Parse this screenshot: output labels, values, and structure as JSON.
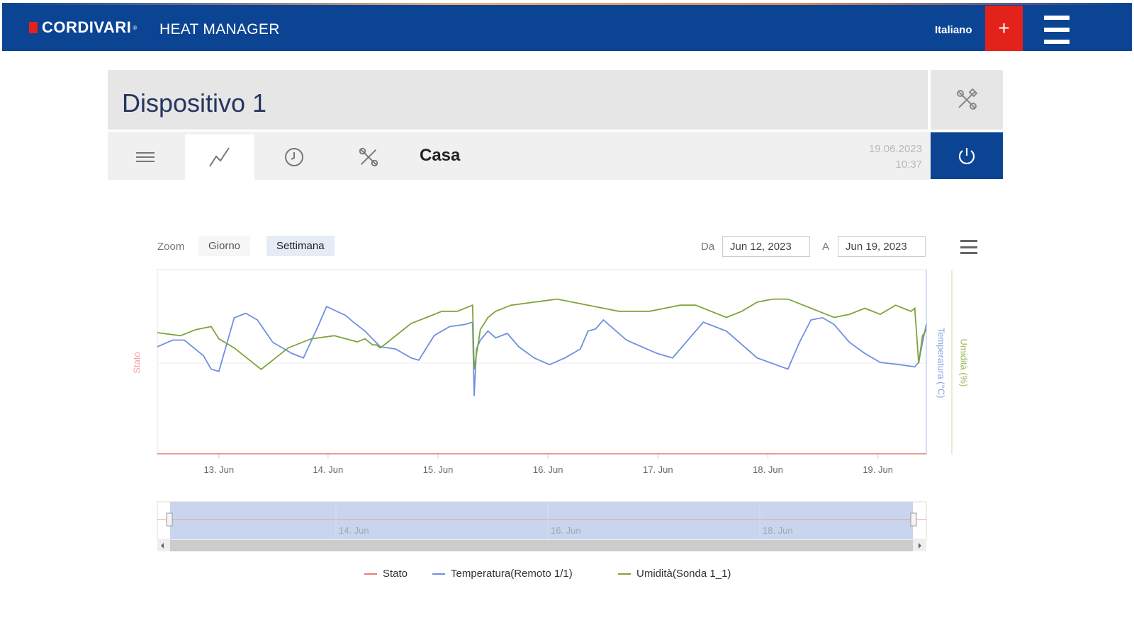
{
  "header": {
    "brand": "CORDIVARI",
    "brand_reg": "®",
    "app_name": "HEAT MANAGER",
    "language": "Italiano",
    "add_label": "+",
    "colors": {
      "bar": "#0c4494",
      "accent": "#e3231b"
    }
  },
  "device": {
    "title": "Dispositivo 1",
    "tabs": [
      {
        "icon": "list-icon"
      },
      {
        "icon": "chart-line-icon",
        "active": true
      },
      {
        "icon": "clock-icon"
      },
      {
        "icon": "tools-icon"
      }
    ],
    "location": "Casa",
    "date": "19.06.2023",
    "time": "10:37"
  },
  "chart_controls": {
    "zoom_label": "Zoom",
    "zoom_day": "Giorno",
    "zoom_week": "Settimana",
    "from_label": "Da",
    "from_value": "Jun 12, 2023",
    "to_label": "A",
    "to_value": "Jun 19, 2023"
  },
  "chart_data": {
    "type": "line",
    "x_start": "2023-06-12 12:00",
    "x_end": "2023-06-19 10:37",
    "x_ticks": [
      "13. Jun",
      "14. Jun",
      "15. Jun",
      "16. Jun",
      "17. Jun",
      "18. Jun",
      "19. Jun"
    ],
    "y_axes": [
      {
        "title": "Stato",
        "color": "#f3a0a0",
        "side": "left"
      },
      {
        "title": "Temperatura (°C)",
        "color": "#8aa4e6",
        "side": "right"
      },
      {
        "title": "Umidità (%)",
        "color": "#9cb85a",
        "side": "right"
      }
    ],
    "series": [
      {
        "name": "Stato",
        "color": "#ee7a7a",
        "axis": "Stato",
        "x": [
          0,
          1
        ],
        "y": [
          0,
          0
        ]
      },
      {
        "name": "Temperatura(Remoto 1/1)",
        "color": "#6f8fe0",
        "axis": "Temperatura (°C)",
        "x": [
          0.0,
          0.02,
          0.035,
          0.06,
          0.07,
          0.08,
          0.1,
          0.115,
          0.13,
          0.15,
          0.175,
          0.19,
          0.21,
          0.22,
          0.245,
          0.255,
          0.27,
          0.29,
          0.31,
          0.33,
          0.34,
          0.36,
          0.38,
          0.4,
          0.41,
          0.412,
          0.415,
          0.42,
          0.43,
          0.44,
          0.455,
          0.47,
          0.49,
          0.51,
          0.53,
          0.55,
          0.56,
          0.57,
          0.58,
          0.59,
          0.61,
          0.63,
          0.65,
          0.67,
          0.685,
          0.71,
          0.74,
          0.78,
          0.82,
          0.835,
          0.85,
          0.865,
          0.88,
          0.9,
          0.92,
          0.94,
          0.965,
          0.985,
          0.99,
          0.995,
          1.0
        ],
        "y": [
          45,
          48,
          48,
          41,
          35,
          34,
          58,
          60,
          57,
          47,
          42,
          40,
          55,
          63,
          59,
          56,
          52,
          45,
          44,
          40,
          39,
          50,
          54,
          55,
          56,
          23,
          44,
          48,
          52,
          49,
          51,
          45,
          40,
          37,
          40,
          44,
          52,
          53,
          57,
          54,
          48,
          45,
          42,
          40,
          46,
          56,
          52,
          40,
          35,
          47,
          57,
          58,
          55,
          47,
          42,
          38,
          37,
          36,
          38,
          47,
          55
        ]
      },
      {
        "name": "Umidità(Sonda 1_1)",
        "color": "#7fa33a",
        "axis": "Umidità (%)",
        "x": [
          0.0,
          0.03,
          0.05,
          0.07,
          0.08,
          0.1,
          0.12,
          0.135,
          0.15,
          0.17,
          0.2,
          0.23,
          0.26,
          0.27,
          0.28,
          0.285,
          0.29,
          0.3,
          0.33,
          0.35,
          0.37,
          0.39,
          0.41,
          0.412,
          0.42,
          0.43,
          0.44,
          0.46,
          0.49,
          0.52,
          0.54,
          0.56,
          0.58,
          0.6,
          0.62,
          0.64,
          0.66,
          0.68,
          0.7,
          0.72,
          0.74,
          0.76,
          0.78,
          0.8,
          0.82,
          0.84,
          0.86,
          0.88,
          0.9,
          0.92,
          0.94,
          0.96,
          0.98,
          0.985,
          0.99,
          0.995,
          1.0
        ],
        "y": [
          79,
          78,
          80,
          81,
          77,
          74,
          70,
          67,
          70,
          74,
          77,
          78,
          76,
          77,
          75,
          75,
          74,
          76,
          82,
          84,
          86,
          86,
          88,
          67,
          80,
          84,
          86,
          88,
          89,
          90,
          89,
          88,
          87,
          86,
          86,
          86,
          87,
          88,
          88,
          86,
          84,
          86,
          89,
          90,
          90,
          88,
          86,
          84,
          85,
          87,
          85,
          88,
          86,
          87,
          69,
          78,
          80
        ]
      }
    ],
    "legend_position": "bottom-center"
  },
  "navigator": {
    "ticks": [
      "14. Jun",
      "16. Jun",
      "18. Jun"
    ]
  }
}
